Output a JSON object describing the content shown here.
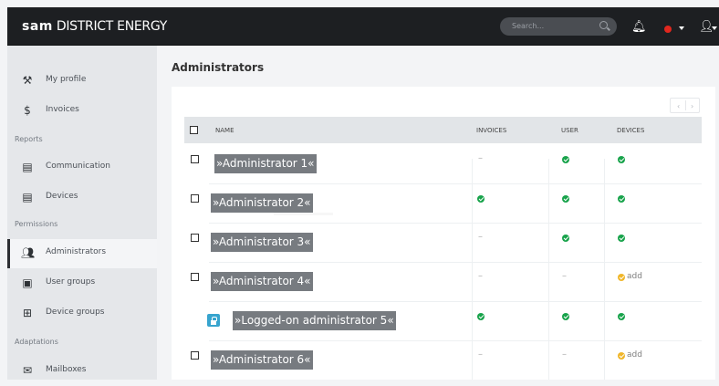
{
  "app": {
    "brand_strong": "sam",
    "brand_rest": "DISTRICT ENERGY"
  },
  "topbar": {
    "search_placeholder": "Search...",
    "icons": [
      "bell-icon",
      "red-dot-icon",
      "user-icon"
    ]
  },
  "sidebar": {
    "items": [
      {
        "label": "My profile",
        "icon": "wrench-icon"
      },
      {
        "label": "Invoices",
        "icon": "dollar-icon"
      },
      {
        "section": "Reports"
      },
      {
        "label": "Communication",
        "icon": "document-icon"
      },
      {
        "label": "Devices",
        "icon": "document-icon"
      },
      {
        "section": "Permissions"
      },
      {
        "label": "Administrators",
        "icon": "users-icon"
      },
      {
        "label": "User groups",
        "icon": "group-icon"
      },
      {
        "label": "Device groups",
        "icon": "device-group-icon"
      },
      {
        "section": "Adaptations"
      },
      {
        "label": "Mailboxes",
        "icon": "mail-icon"
      }
    ]
  },
  "main": {
    "title": "Administrators",
    "pager": {
      "prev": "‹",
      "next": "›"
    },
    "table": {
      "columns": [
        "NAME",
        "INVOICES",
        "USER",
        "DEVICES"
      ],
      "rows": [
        {
          "name": "»Administrator 1«",
          "invoices": "–",
          "user": "ok",
          "devices": "ok"
        },
        {
          "name": "»Administrator 2«",
          "invoices": "ok",
          "user": "ok",
          "devices": "ok"
        },
        {
          "name": "»Administrator 3«",
          "invoices": "–",
          "user": "ok",
          "devices": "ok"
        },
        {
          "name": "»Administrator 4«",
          "invoices": "–",
          "user": "–",
          "devices": "add"
        },
        {
          "name": "»Logged-on administrator 5«",
          "invoices": "ok",
          "user": "ok",
          "devices": "ok"
        },
        {
          "name": "»Administrator 6«",
          "invoices": "–",
          "user": "–",
          "devices": "add"
        }
      ],
      "add_label": "add"
    }
  },
  "colors": {
    "topbar": "#1d1f22",
    "sidebar": "#e5e7ea",
    "accent_red": "#e1271e",
    "ok_green": "#18a34b",
    "warn_yellow": "#f0b629",
    "name_label_gray": "#777b80"
  }
}
